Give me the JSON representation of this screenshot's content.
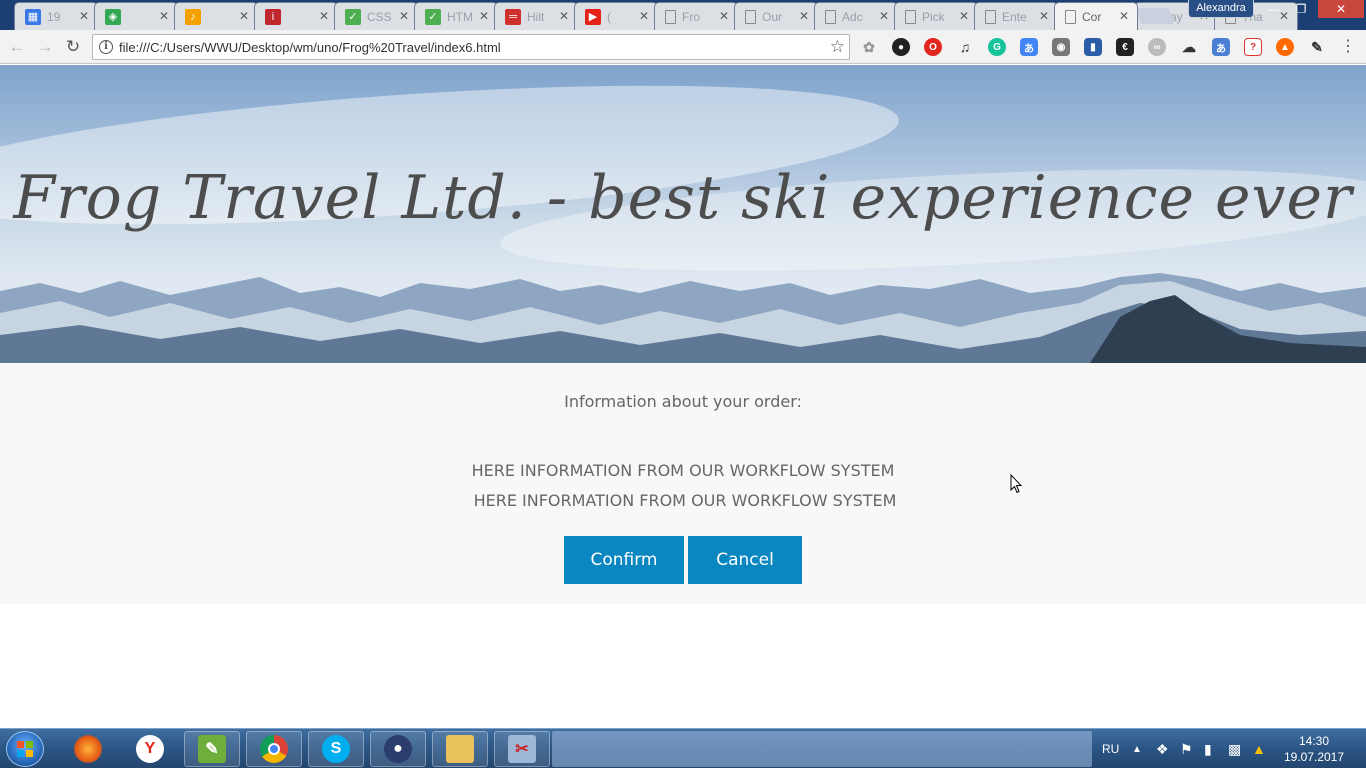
{
  "browser": {
    "tabs": [
      {
        "title": "19",
        "icon": "calendar-icon",
        "color": "#3b78e7"
      },
      {
        "title": "",
        "icon": "maps-icon",
        "color": "#34a853"
      },
      {
        "title": "",
        "icon": "music-icon",
        "color": "#f4a100"
      },
      {
        "title": "",
        "icon": "info-icon",
        "color": "#c0272d"
      },
      {
        "title": "CSS",
        "icon": "w3-icon",
        "color": "#4caf50"
      },
      {
        "title": "HTM",
        "icon": "w3-icon",
        "color": "#4caf50"
      },
      {
        "title": "Hilt",
        "icon": "hilton-icon",
        "color": "#d0312d"
      },
      {
        "title": "(",
        "icon": "youtube-icon",
        "color": "#e62117"
      },
      {
        "title": "Fro",
        "icon": "document-icon",
        "color": "#888888"
      },
      {
        "title": "Our",
        "icon": "document-icon",
        "color": "#888888"
      },
      {
        "title": "Adc",
        "icon": "document-icon",
        "color": "#888888"
      },
      {
        "title": "Pick",
        "icon": "document-icon",
        "color": "#888888"
      },
      {
        "title": "Ente",
        "icon": "document-icon",
        "color": "#888888"
      },
      {
        "title": "Cor",
        "icon": "document-icon",
        "color": "#888888",
        "active": true
      },
      {
        "title": "Pay",
        "icon": "document-icon",
        "color": "#888888"
      },
      {
        "title": "Tha",
        "icon": "document-icon",
        "color": "#888888"
      }
    ],
    "profile_name": "Alexandra",
    "url": "file:///C:/Users/WWU/Desktop/wm/uno/Frog%20Travel/index6.html"
  },
  "page": {
    "hero_title": "Frog Travel Ltd. - best ski experience ever",
    "order_heading": "Information about your order:",
    "info_lines": [
      "HERE INFORMATION FROM OUR WORKFLOW SYSTEM",
      "HERE INFORMATION FROM OUR WORKFLOW SYSTEM"
    ],
    "confirm_label": "Confirm",
    "cancel_label": "Cancel",
    "button_color": "#0a86c0"
  },
  "taskbar": {
    "language": "RU",
    "time": "14:30",
    "date": "19.07.2017"
  }
}
